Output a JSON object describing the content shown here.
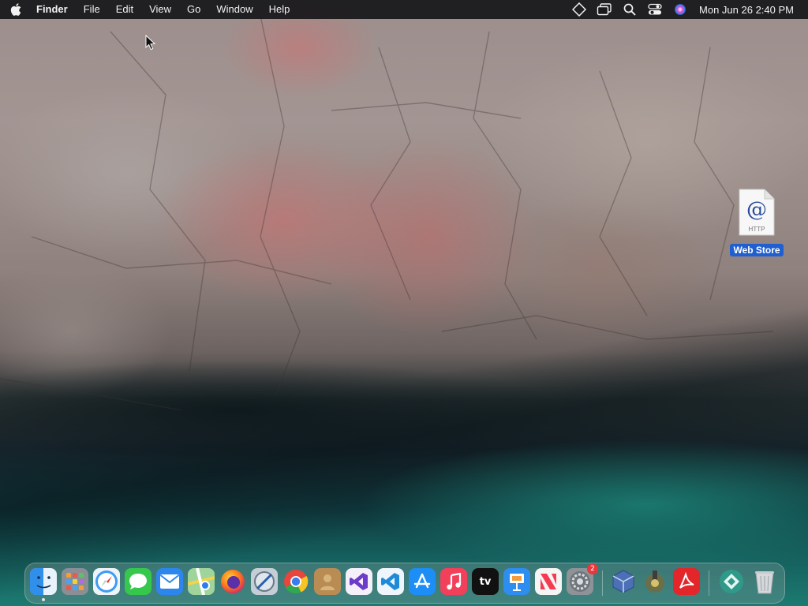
{
  "menubar": {
    "apple_icon": "apple-logo-icon",
    "app_name": "Finder",
    "menus": [
      "File",
      "Edit",
      "View",
      "Go",
      "Window",
      "Help"
    ],
    "status_icons": [
      "stage-diamond-icon",
      "screen-mirroring-icon",
      "spotlight-search-icon",
      "control-center-icon",
      "siri-icon"
    ],
    "clock": "Mon Jun 26  2:40 PM"
  },
  "desktop": {
    "icons": [
      {
        "label": "Web Store",
        "icon": "http-location-file-icon",
        "doc_symbol": "@",
        "doc_caption": "HTTP",
        "selected": true
      }
    ]
  },
  "dock": {
    "apps": [
      {
        "name": "Finder",
        "icon": "finder-icon",
        "color": "#2f8fea",
        "running": true
      },
      {
        "name": "Launchpad",
        "icon": "launchpad-icon",
        "color": "#8a8f96"
      },
      {
        "name": "Safari",
        "icon": "safari-icon",
        "color": "#3d9bf2"
      },
      {
        "name": "Messages",
        "icon": "messages-icon",
        "color": "#36c84c"
      },
      {
        "name": "Mail",
        "icon": "mail-icon",
        "color": "#2c86ee"
      },
      {
        "name": "Maps",
        "icon": "maps-icon",
        "color": "#5fb36a"
      },
      {
        "name": "Firefox",
        "icon": "firefox-icon",
        "color": "#ff7a18"
      },
      {
        "name": "Network Utility",
        "icon": "network-utility-icon",
        "color": "#b9c3cc"
      },
      {
        "name": "Google Chrome",
        "icon": "chrome-icon",
        "color": "#e8e8e8"
      },
      {
        "name": "Contacts",
        "icon": "contacts-icon",
        "color": "#b88c52"
      },
      {
        "name": "Visual Studio",
        "icon": "visual-studio-icon",
        "color": "#6c3bc7"
      },
      {
        "name": "Visual Studio Code",
        "icon": "vscode-icon",
        "color": "#1f8ad8"
      },
      {
        "name": "App Store",
        "icon": "app-store-icon",
        "color": "#1d8ef5"
      },
      {
        "name": "Music",
        "icon": "music-icon",
        "color": "#f2405a"
      },
      {
        "name": "Apple TV",
        "icon": "apple-tv-icon",
        "color": "#111111",
        "glyph": "tv"
      },
      {
        "name": "Keynote",
        "icon": "keynote-icon",
        "color": "#2d8ef0"
      },
      {
        "name": "News",
        "icon": "news-icon",
        "color": "#f5f5f5"
      },
      {
        "name": "System Settings",
        "icon": "system-settings-icon",
        "color": "#8e9398",
        "badge": "2"
      },
      {
        "name": "VirtualBox",
        "icon": "virtualbox-icon",
        "color": "#4c70b7"
      },
      {
        "name": "Archive Utility",
        "icon": "archive-utility-icon",
        "color": "#6a6f4a"
      },
      {
        "name": "Adobe Acrobat",
        "icon": "acrobat-icon",
        "color": "#e3262a"
      },
      {
        "name": "Downloads",
        "icon": "downloads-stack-icon",
        "color": "#2f9a8a"
      },
      {
        "name": "Trash",
        "icon": "trash-icon",
        "color": "#c9cccf"
      }
    ]
  }
}
